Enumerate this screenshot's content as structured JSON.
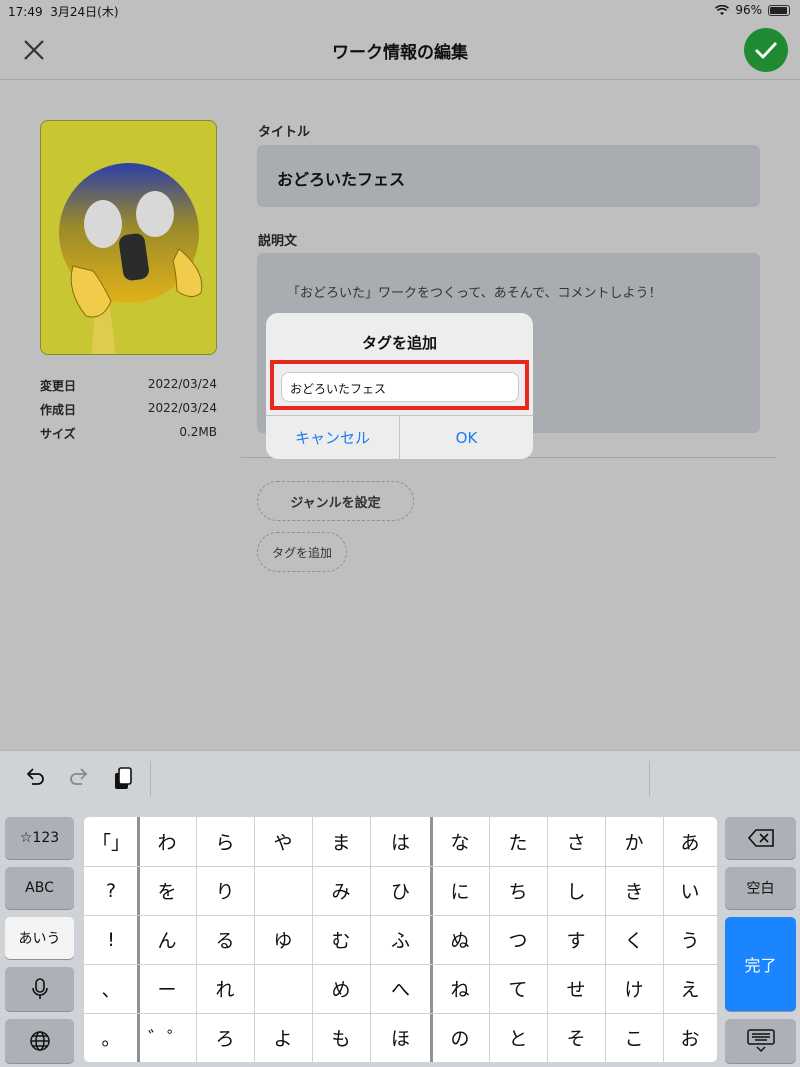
{
  "status_bar": {
    "time": "17:49",
    "date": "3月24日(木)",
    "battery": "96%"
  },
  "header": {
    "title": "ワーク情報の編集"
  },
  "meta": [
    {
      "label": "変更日",
      "value": "2022/03/24"
    },
    {
      "label": "作成日",
      "value": "2022/03/24"
    },
    {
      "label": "サイズ",
      "value": "0.2MB"
    }
  ],
  "form": {
    "title_label": "タイトル",
    "title_value": "おどろいたフェス",
    "desc_label": "説明文",
    "desc_value": "「おどろいた」ワークをつくって、あそんで、コメントしよう！",
    "genre_button": "ジャンルを設定",
    "tag_button": "タグを追加"
  },
  "dialog": {
    "title": "タグを追加",
    "input_value": "おどろいたフェス",
    "cancel": "キャンセル",
    "ok": "OK"
  },
  "keyboard": {
    "left": [
      "☆123",
      "ABC",
      "あいう"
    ],
    "right": [
      "空白",
      "完了"
    ],
    "grid": [
      [
        "「」",
        "わ",
        "ら",
        "や",
        "ま",
        "は",
        "な",
        "た",
        "さ",
        "か",
        "あ"
      ],
      [
        "?",
        "を",
        "り",
        "",
        "み",
        "ひ",
        "に",
        "ち",
        "し",
        "き",
        "い"
      ],
      [
        "!",
        "ん",
        "る",
        "ゆ",
        "む",
        "ふ",
        "ぬ",
        "つ",
        "す",
        "く",
        "う"
      ],
      [
        "、",
        "ー",
        "れ",
        "",
        "め",
        "へ",
        "ね",
        "て",
        "せ",
        "け",
        "え"
      ],
      [
        "。",
        "゛゜",
        "ろ",
        "よ",
        "も",
        "ほ",
        "の",
        "と",
        "そ",
        "こ",
        "お"
      ]
    ]
  }
}
